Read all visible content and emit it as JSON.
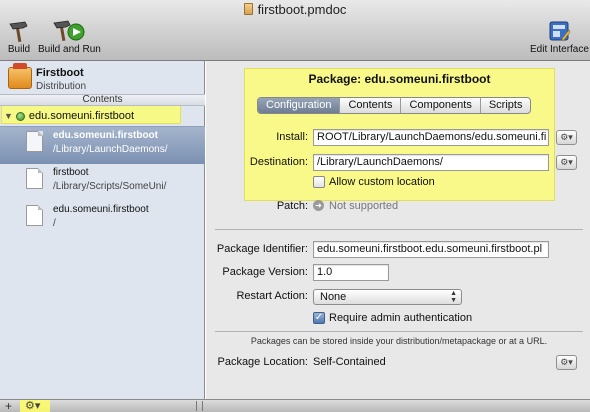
{
  "window": {
    "title": "firstboot.pmdoc"
  },
  "toolbar": {
    "build_label": "Build",
    "build_and_run_label": "Build and Run",
    "edit_interface_label": "Edit Interface"
  },
  "sidebar": {
    "distribution": {
      "name": "Firstboot",
      "subtitle": "Distribution"
    },
    "contents_label": "Contents",
    "package_name": "edu.someuni.firstboot",
    "files": [
      {
        "name": "edu.someuni.firstboot",
        "path": "/Library/LaunchDaemons/",
        "selected": true
      },
      {
        "name": "firstboot",
        "path": "/Library/Scripts/SomeUni/",
        "selected": false
      },
      {
        "name": "edu.someuni.firstboot",
        "path": "/",
        "selected": false
      }
    ]
  },
  "main": {
    "package_title": "Package: edu.someuni.firstboot",
    "tabs": [
      "Configuration",
      "Contents",
      "Components",
      "Scripts"
    ],
    "active_tab": "Configuration",
    "install_label": "Install:",
    "install_value": "ROOT/Library/LaunchDaemons/edu.someuni.fi",
    "destination_label": "Destination:",
    "destination_value": "/Library/LaunchDaemons/",
    "allow_custom_label": "Allow custom location",
    "allow_custom_checked": false,
    "patch_label": "Patch:",
    "patch_value": "Not supported",
    "package_identifier_label": "Package Identifier:",
    "package_identifier_value": "edu.someuni.firstboot.edu.someuni.firstboot.pl",
    "package_version_label": "Package Version:",
    "package_version_value": "1.0",
    "restart_action_label": "Restart Action:",
    "restart_action_value": "None",
    "require_admin_label": "Require admin authentication",
    "require_admin_checked": true,
    "storage_note": "Packages can be stored inside your distribution/metapackage or at a URL.",
    "package_location_label": "Package Location:",
    "package_location_value": "Self-Contained"
  },
  "bottombar": {
    "add_symbol": "+"
  },
  "colors": {
    "highlight": "#ffff64",
    "selection": "#7b91b1",
    "tab_active": "#6d7d93"
  },
  "icons": [
    "document-icon",
    "hammer-icon",
    "build-and-run-icon",
    "edit-interface-icon",
    "distribution-box-icon",
    "package-icon",
    "file-icon",
    "gear-icon",
    "patch-arrow-icon",
    "checkmark-icon"
  ]
}
